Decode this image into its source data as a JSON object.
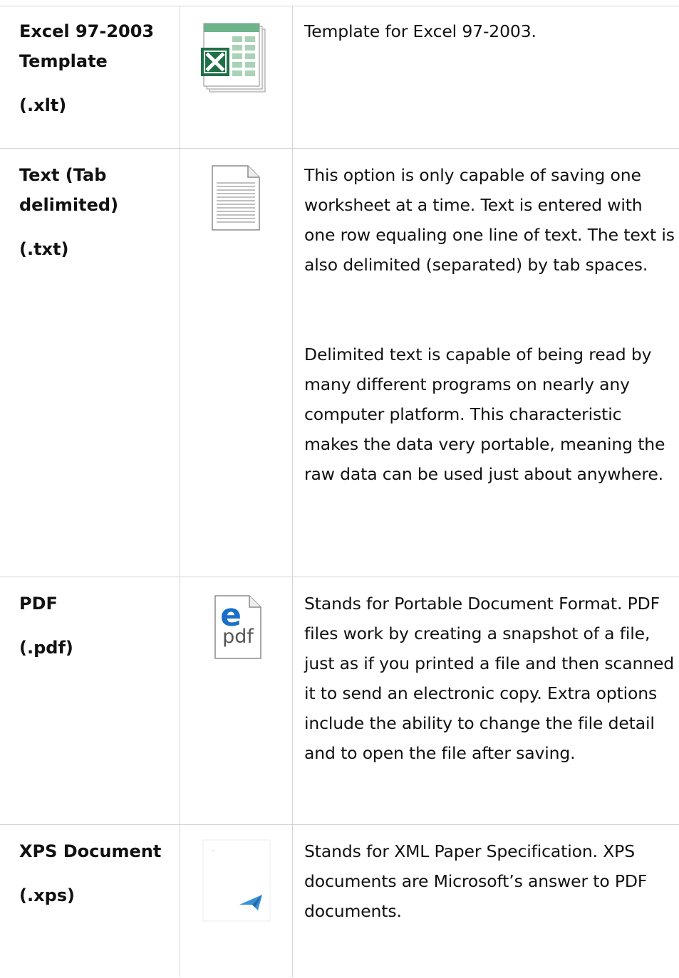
{
  "rows": [
    {
      "name": "Excel 97-2003 Template",
      "ext": "(.xlt)",
      "icon": "excel-template-icon",
      "description": [
        "Template for Excel 97-2003."
      ]
    },
    {
      "name": "Text (Tab delimited)",
      "ext": "(.txt)",
      "icon": "text-document-icon",
      "description": [
        "This option is only capable of saving one worksheet at a time. Text is entered with one row equaling one line of text. The text is also delimited (separated) by tab spaces.",
        "Delimited text is capable of being read by many different programs on nearly any computer platform. This characteristic makes the data very portable, meaning the raw data can be used just about anywhere."
      ]
    },
    {
      "name": "PDF",
      "ext": "(.pdf)",
      "icon": "pdf-edge-icon",
      "icon_label": "pdf",
      "description": [
        "Stands for Portable Document Format. PDF files work by creating a snapshot of a file, just as if you printed a file and then scanned it to send an electronic copy. Extra options include the ability to change the file detail and to open the file after saving."
      ]
    },
    {
      "name": "XPS Document",
      "ext": "(.xps)",
      "icon": "xps-document-icon",
      "description": [
        "Stands for XML Paper Specification. XPS documents are Microsoft’s answer to PDF documents."
      ]
    }
  ],
  "colors": {
    "border": "#d4d4d4",
    "excel_green": "#1e7145",
    "edge_blue": "#1a6fc9",
    "xps_blue": "#3a8fd6"
  }
}
